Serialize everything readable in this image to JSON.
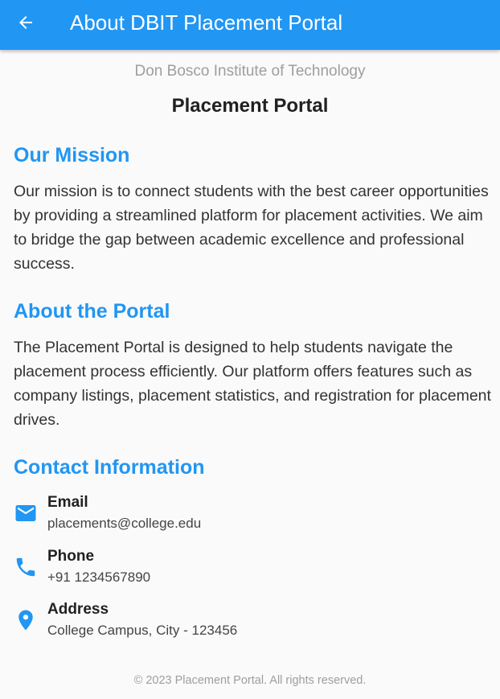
{
  "appbar": {
    "title": "About DBIT Placement Portal",
    "back_icon": "arrow-back-icon"
  },
  "header": {
    "institute": "Don Bosco Institute of Technology",
    "title": "Placement Portal"
  },
  "mission": {
    "heading": "Our Mission",
    "text": "Our mission is to connect students with the best career opportunities by providing a streamlined platform for placement activities. We aim to bridge the gap between academic excellence and professional success."
  },
  "about": {
    "heading": "About the Portal",
    "text": "The Placement Portal is designed to help students navigate the placement process efficiently. Our platform offers features such as company listings, placement statistics, and registration for placement drives."
  },
  "contact": {
    "heading": "Contact Information",
    "items": [
      {
        "icon": "email-icon",
        "label": "Email",
        "value": "placements@college.edu"
      },
      {
        "icon": "phone-icon",
        "label": "Phone",
        "value": "+91 1234567890"
      },
      {
        "icon": "location-pin-icon",
        "label": "Address",
        "value": "College Campus, City - 123456"
      }
    ]
  },
  "footer": {
    "text": "© 2023 Placement Portal. All rights reserved."
  },
  "colors": {
    "primary": "#2196f3",
    "heading_text": "#212121",
    "muted_text": "#9e9e9e"
  }
}
